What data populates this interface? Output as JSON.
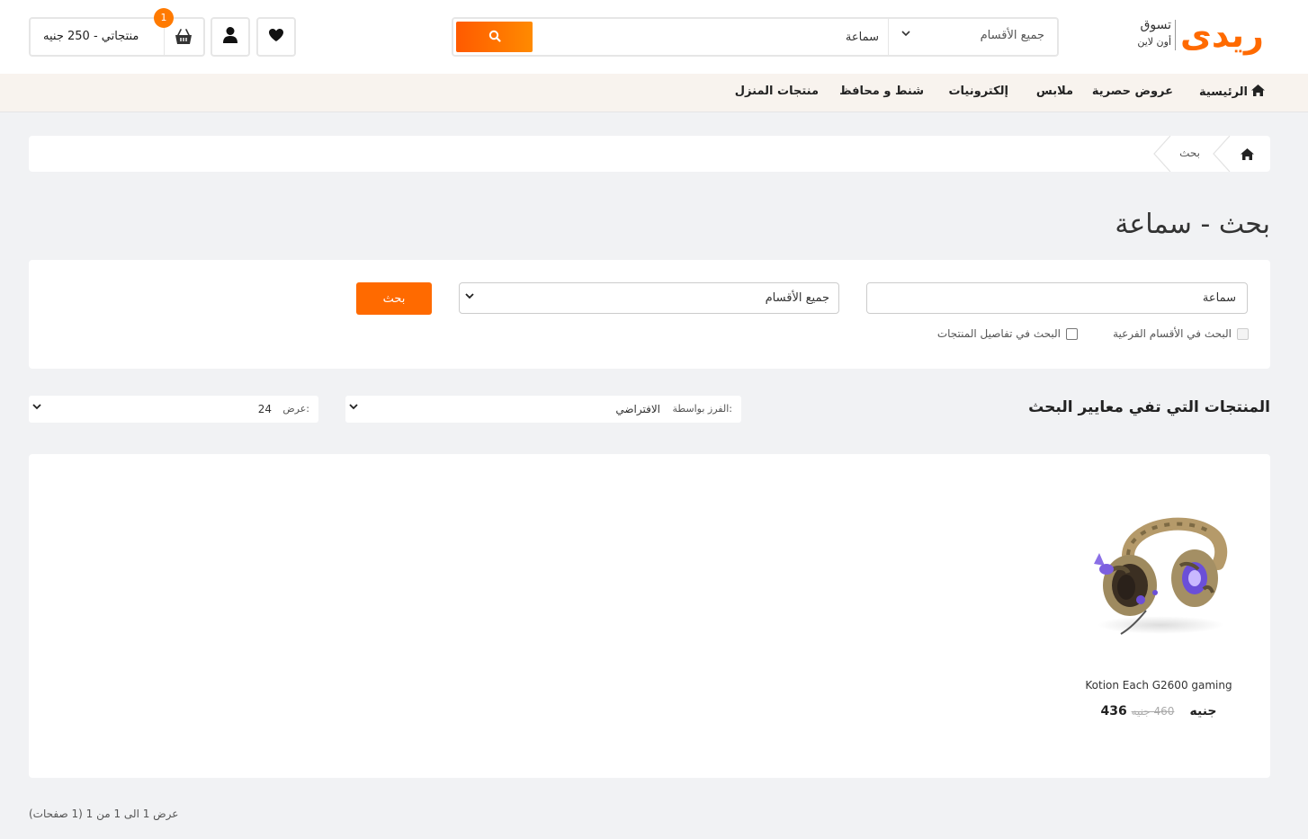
{
  "header": {
    "logo_mark": "ريدى",
    "logo_line1": "تسوق",
    "logo_line2": "أون لاين",
    "search": {
      "category": "جميع الأقسام",
      "query": "سماعة"
    },
    "cart": {
      "label": "منتجاتي - 250 جنيه",
      "count": "1"
    }
  },
  "nav": {
    "items": [
      {
        "label": "الرئيسية",
        "icon": "home-icon"
      },
      {
        "label": "عروض حصرية"
      },
      {
        "label": "ملابس"
      },
      {
        "label": "إلكترونيات"
      },
      {
        "label": "شنط و محافظ"
      },
      {
        "label": "منتجات المنزل"
      }
    ]
  },
  "breadcrumb": {
    "current": "بحث"
  },
  "page": {
    "title": "بحث - سماعة"
  },
  "search_panel": {
    "query": "سماعة",
    "category": "جميع الأقسام",
    "button": "بحث",
    "subcategories_label": "البحث في الأقسام الفرعية",
    "details_label": "البحث في تفاصيل المنتجات"
  },
  "results": {
    "title": "المنتجات التي تفي معايير البحث",
    "sort_label": "الفرز بواسطة:",
    "sort_value": "الافتراضي",
    "limit_label": "عرض:",
    "limit_value": "24"
  },
  "products": [
    {
      "name": "Kotion Each G2600 gaming",
      "price": "436 جنيه",
      "old_price": "460 جنيه"
    }
  ],
  "pagination": {
    "info": "عرض 1 الى 1 من 1 (1 صفحات)"
  },
  "colors": {
    "accent": "#ff6a00",
    "nav_bg": "#f8f3ee",
    "page_bg": "#f1f2f4"
  }
}
